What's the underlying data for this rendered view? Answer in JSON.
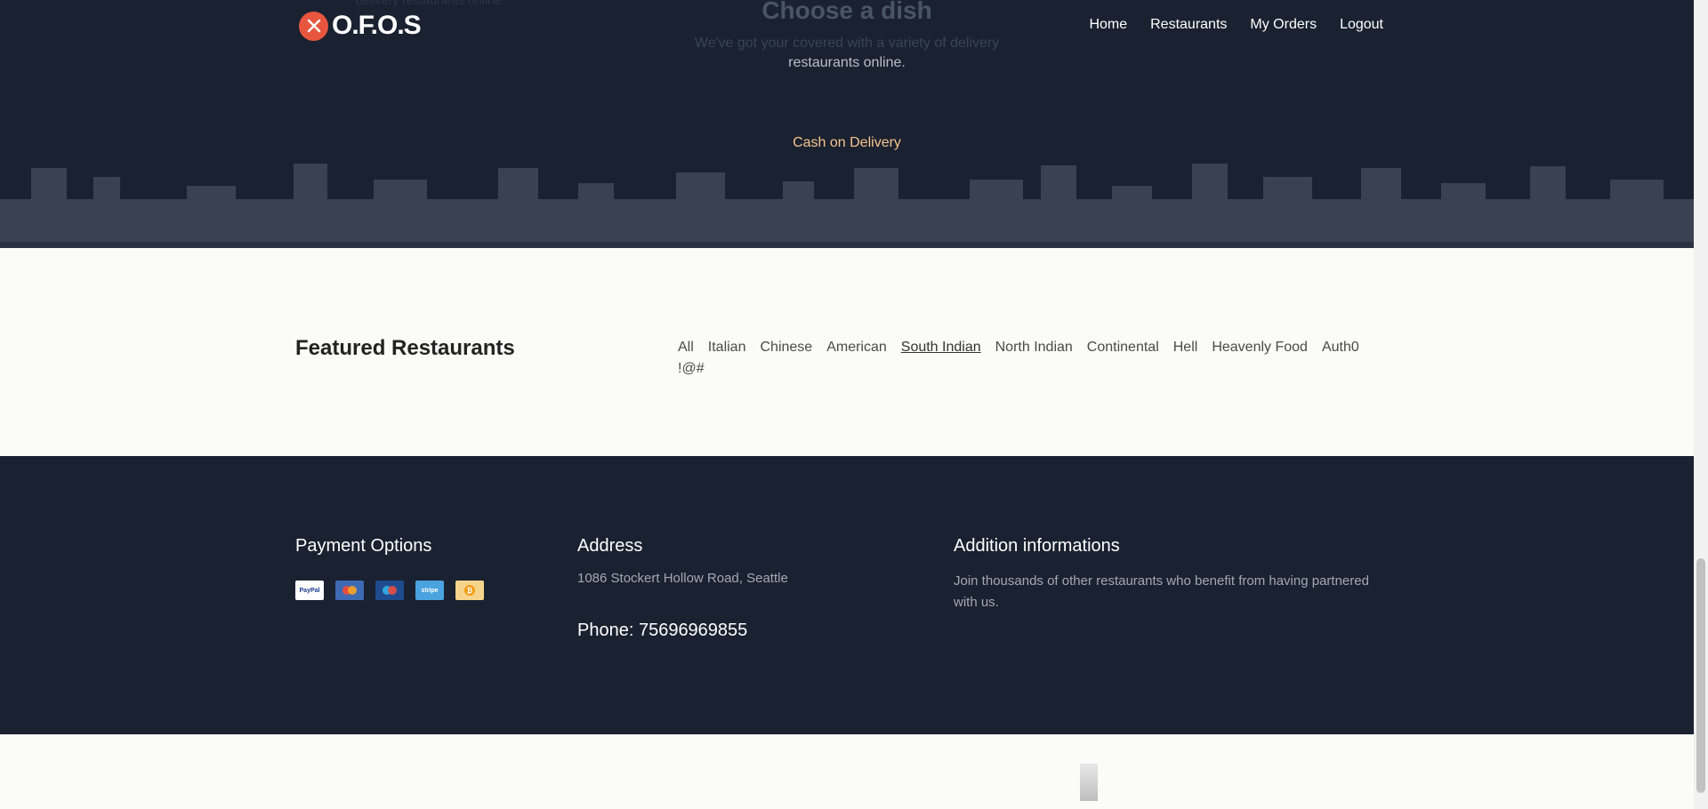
{
  "brand": {
    "name": "O.F.O.S",
    "accent": "#e8563f"
  },
  "nav": [
    "Home",
    "Restaurants",
    "My Orders",
    "Logout"
  ],
  "hero": {
    "title": "Choose a dish",
    "subtitle_faded": "We've got your covered with a variety of delivery",
    "subtitle": "restaurants online.",
    "behind_text": "delivery restaurants online.",
    "payment_note": "Cash on Delivery"
  },
  "featured": {
    "title": "Featured Restaurants",
    "filters": [
      "All",
      "Italian",
      "Chinese",
      "American",
      "South Indian",
      "North Indian",
      "Continental",
      "Hell",
      "Heavenly Food",
      "Auth0",
      "!@#"
    ],
    "active_filter": "South Indian"
  },
  "footer": {
    "payment_title": "Payment Options",
    "payment_icons": [
      "paypal-icon",
      "mastercard-icon",
      "maestro-icon",
      "stripe-icon",
      "bitcoin-icon"
    ],
    "paypal_label": "PayPal",
    "stripe_label": "stripe",
    "address_title": "Address",
    "address": "1086 Stockert Hollow Road, Seattle",
    "phone": "Phone: 75696969855",
    "additional_title": "Addition informations",
    "additional_text": "Join thousands of other restaurants who benefit from having partnered with us."
  },
  "colors": {
    "dark_bg": "#1a2130",
    "light_bg": "#fbfbf8",
    "cash_text": "#f5c58d"
  }
}
